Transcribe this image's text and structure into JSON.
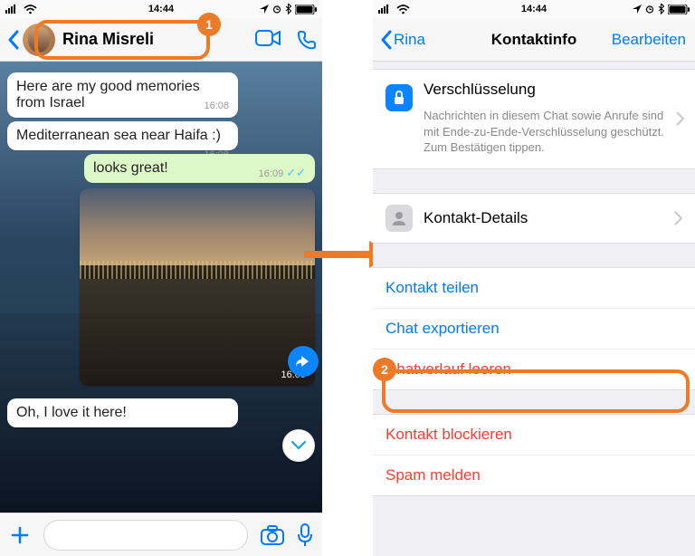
{
  "status": {
    "time": "14:44"
  },
  "callouts": {
    "one": "1",
    "two": "2"
  },
  "left": {
    "contactName": "Rina Misreli",
    "msg1": "Here are my good memories from Israel",
    "msg1time": "16:08",
    "msg2": "Mediterranea﻿n sea near Haifa :)",
    "msg2time": "16:08",
    "msg3": "looks great!",
    "msg3time": "16:09",
    "mediaTime": "16:09",
    "msg4": "Oh, I love it here!"
  },
  "right": {
    "back": "Rina",
    "title": "Kontaktinfo",
    "edit": "Bearbeiten",
    "encTitle": "Verschlüsselung",
    "encSub": "Nachrichten in diesem Chat sowie Anrufe sind mit Ende-zu-Ende-Verschlüsselung geschützt. Zum Bestätigen tippen.",
    "contactDetails": "Kontakt-Details",
    "shareContact": "Kontakt teilen",
    "exportChat": "Chat exportieren",
    "clearChat": "Chatverlauf leeren",
    "blockContact": "Kontakt blockieren",
    "reportSpam": "Spam melden"
  }
}
